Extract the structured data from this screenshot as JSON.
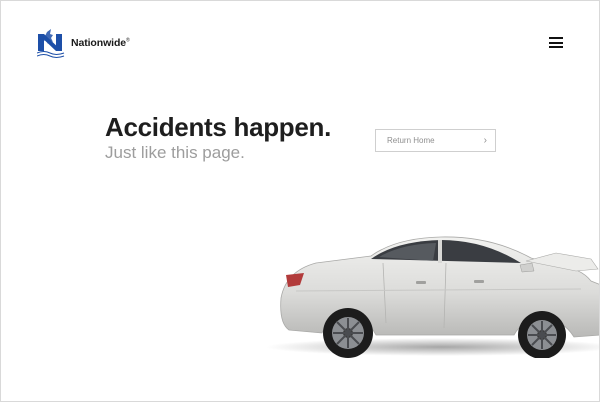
{
  "header": {
    "brand_name": "Nationwide",
    "brand_reg": "®",
    "logo_icon": "nationwide-eagle-logo",
    "menu_icon": "hamburger-menu-icon"
  },
  "hero": {
    "headline": "Accidents happen.",
    "subheadline": "Just like this page.",
    "return_button_label": "Return Home",
    "return_button_icon": "chevron-right-icon"
  },
  "illustration": {
    "subject": "car-illustration",
    "car_color": "#e6e6e4"
  },
  "colors": {
    "brand_blue": "#1d4fa8",
    "headline": "#1e1e1e",
    "subheadline": "#9d9d9d",
    "button_border": "#cfcfcf"
  }
}
